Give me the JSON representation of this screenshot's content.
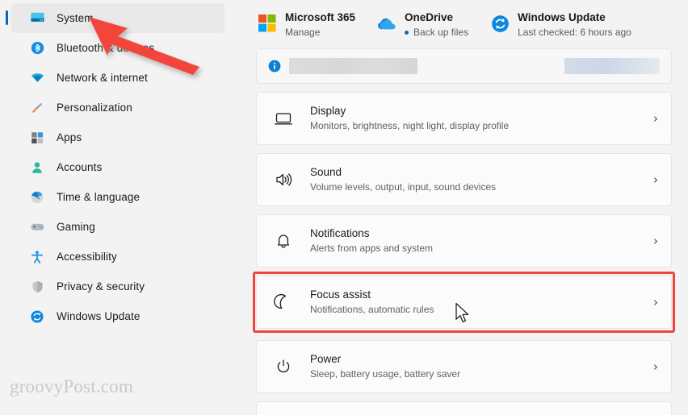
{
  "sidebar": {
    "items": [
      {
        "label": "System",
        "icon": "monitor-icon",
        "selected": true
      },
      {
        "label": "Bluetooth & devices",
        "icon": "bluetooth-icon",
        "selected": false
      },
      {
        "label": "Network & internet",
        "icon": "wifi-icon",
        "selected": false
      },
      {
        "label": "Personalization",
        "icon": "paintbrush-icon",
        "selected": false
      },
      {
        "label": "Apps",
        "icon": "apps-icon",
        "selected": false
      },
      {
        "label": "Accounts",
        "icon": "person-icon",
        "selected": false
      },
      {
        "label": "Time & language",
        "icon": "clock-icon",
        "selected": false
      },
      {
        "label": "Gaming",
        "icon": "gamepad-icon",
        "selected": false
      },
      {
        "label": "Accessibility",
        "icon": "accessibility-icon",
        "selected": false
      },
      {
        "label": "Privacy & security",
        "icon": "shield-icon",
        "selected": false
      },
      {
        "label": "Windows Update",
        "icon": "update-icon",
        "selected": false
      }
    ],
    "watermark": "groovyPost.com"
  },
  "header_cards": [
    {
      "title": "Microsoft 365",
      "subtitle": "Manage",
      "icon": "microsoft-logo-icon",
      "has_dot": false
    },
    {
      "title": "OneDrive",
      "subtitle": "Back up files",
      "icon": "onedrive-cloud-icon",
      "has_dot": true
    },
    {
      "title": "Windows Update",
      "subtitle": "Last checked: 6 hours ago",
      "icon": "update-icon",
      "has_dot": false
    }
  ],
  "info_card": {
    "icon": "info-icon",
    "left_text": "",
    "right_text": ""
  },
  "settings_rows": [
    {
      "title": "Display",
      "subtitle": "Monitors, brightness, night light, display profile",
      "icon": "display-icon",
      "chevron": "›",
      "highlighted": false
    },
    {
      "title": "Sound",
      "subtitle": "Volume levels, output, input, sound devices",
      "icon": "speaker-icon",
      "chevron": "›",
      "highlighted": false
    },
    {
      "title": "Notifications",
      "subtitle": "Alerts from apps and system",
      "icon": "bell-icon",
      "chevron": "›",
      "highlighted": false
    },
    {
      "title": "Focus assist",
      "subtitle": "Notifications, automatic rules",
      "icon": "moon-icon",
      "chevron": "›",
      "highlighted": true
    },
    {
      "title": "Power",
      "subtitle": "Sleep, battery usage, battery saver",
      "icon": "power-icon",
      "chevron": "›",
      "highlighted": false
    }
  ],
  "annotations": {
    "arrow_color": "#f4453c",
    "highlight_color": "#f2443c",
    "accent_color": "#0067c0",
    "cursor": "arrow-cursor"
  }
}
